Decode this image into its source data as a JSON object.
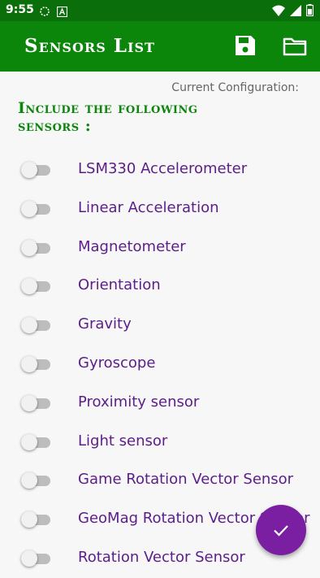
{
  "status_bar": {
    "time": "9:55",
    "icons": [
      "sync-icon",
      "notification-a-icon",
      "wifi-icon",
      "signal-icon",
      "battery-icon"
    ]
  },
  "app_bar": {
    "title": "Sensors List",
    "actions": [
      "save-icon",
      "folder-icon"
    ],
    "color": "#0b860b"
  },
  "config": {
    "label": "Current Configuration:"
  },
  "heading": {
    "text": "Include the following sensors :"
  },
  "sensors": [
    {
      "label": "LSM330 Accelerometer",
      "enabled": false
    },
    {
      "label": "Linear Acceleration",
      "enabled": false
    },
    {
      "label": "Magnetometer",
      "enabled": false
    },
    {
      "label": "Orientation",
      "enabled": false
    },
    {
      "label": "Gravity",
      "enabled": false
    },
    {
      "label": "Gyroscope",
      "enabled": false
    },
    {
      "label": "Proximity sensor",
      "enabled": false
    },
    {
      "label": "Light sensor",
      "enabled": false
    },
    {
      "label": "Game Rotation Vector Sensor",
      "enabled": false
    },
    {
      "label": "GeoMag Rotation Vector Sensor",
      "enabled": false
    },
    {
      "label": "Rotation Vector Sensor",
      "enabled": false
    }
  ],
  "fab": {
    "icon": "check-icon",
    "color": "#7b1fa2"
  }
}
